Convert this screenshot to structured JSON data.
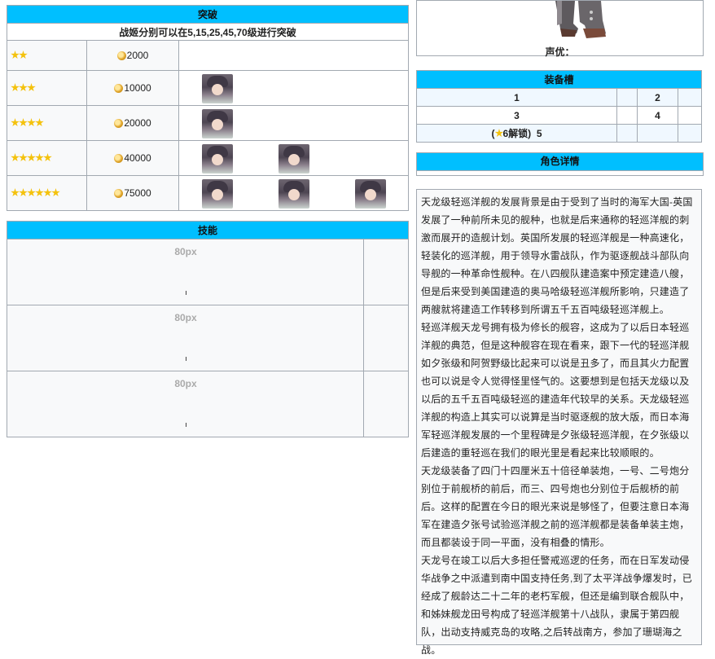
{
  "breakthrough": {
    "header": "突破",
    "note": "战姬分别可以在5,15,25,45,70级进行突破",
    "rows": [
      {
        "stars": 2,
        "cost": "2000",
        "portraits": 0
      },
      {
        "stars": 3,
        "cost": "10000",
        "portraits": 1
      },
      {
        "stars": 4,
        "cost": "20000",
        "portraits": 1
      },
      {
        "stars": 5,
        "cost": "40000",
        "portraits": 2
      },
      {
        "stars": 6,
        "cost": "75000",
        "portraits": 3
      }
    ]
  },
  "skills": {
    "header": "技能",
    "rows": [
      {
        "placeholder": "80px"
      },
      {
        "placeholder": "80px"
      },
      {
        "placeholder": "80px"
      }
    ]
  },
  "voice": {
    "label": "声优："
  },
  "equipment": {
    "header": "装备槽",
    "slot1": "1",
    "slot2": "2",
    "slot3": "3",
    "slot4": "4",
    "slot5_prefix": "(",
    "slot5_lock": "6解锁)",
    "slot5": "5"
  },
  "details": {
    "header": "角色详情",
    "paragraphs": [
      "天龙级轻巡洋舰的发展背景是由于受到了当时的海军大国-英国发展了一种前所未见的舰种，也就是后来通称的轻巡洋舰的刺激而展开的造舰计划。英国所发展的轻巡洋舰是一种高速化，轻装化的巡洋舰，用于领导水雷战队，作为驱逐舰战斗部队向导舰的一种革命性舰种。在八四舰队建造案中预定建造八艘，但是后来受到美国建造的奥马哈级轻巡洋舰所影响，只建造了两艘就将建造工作转移到所谓五千五百吨级轻巡洋舰上。",
      "轻巡洋舰天龙号拥有极为修长的舰容，这成为了以后日本轻巡洋舰的典范，但是这种舰容在现在看来，跟下一代的轻巡洋舰如夕张级和阿贺野级比起来可以说是丑多了，而且其火力配置也可以说是令人觉得怪里怪气的。这要想到是包括天龙级以及以后的五千五百吨级轻巡的建造年代较早的关系。天龙级轻巡洋舰的构造上其实可以说算是当时驱逐舰的放大版，而日本海军轻巡洋舰发展的一个里程碑是夕张级轻巡洋舰，在夕张级以后建造的重轻巡在我们的眼光里是看起来比较顺眼的。",
      "天龙级装备了四门十四厘米五十倍径单装炮，一号、二号炮分别位于前舰桥的前后，而三、四号炮也分别位于后舰桥的前后。这样的配置在今日的眼光来说是够怪了，但要注意日本海军在建造夕张号试验巡洋舰之前的巡洋舰都是装备单装主炮，而且都装设于同一平面，没有相叠的情形。",
      "天龙号在竣工以后大多担任警戒巡逻的任务，而在日军发动侵华战争之中派遣到南中国支持任务,到了太平洋战争爆发时，已经成了舰龄达二十二年的老朽军舰，但还是编到联合舰队中，和姊妹舰龙田号构成了轻巡洋舰第十八战队，隶属于第四舰队，出动支持威克岛的攻略,之后转战南方，参加了珊瑚海之战。"
    ]
  }
}
